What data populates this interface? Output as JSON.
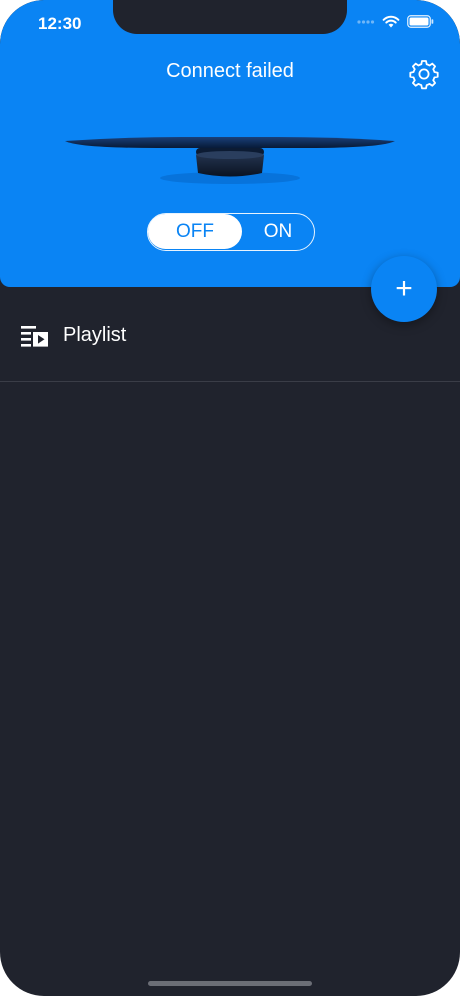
{
  "status_bar": {
    "time": "12:30",
    "icons": [
      "signal-icon",
      "wifi-icon",
      "battery-icon"
    ]
  },
  "header": {
    "title": "Connect failed",
    "settings_icon": "gear-icon",
    "device_image": "hologram-fan-device"
  },
  "power_toggle": {
    "off_label": "OFF",
    "on_label": "ON",
    "selected": "OFF"
  },
  "fab": {
    "label": "+",
    "icon": "plus-icon"
  },
  "list": {
    "items": [
      {
        "icon": "playlist-icon",
        "label": "Playlist"
      }
    ]
  },
  "colors": {
    "accent": "#0a84f4",
    "background": "#20232d",
    "divider": "#3a3d47"
  }
}
